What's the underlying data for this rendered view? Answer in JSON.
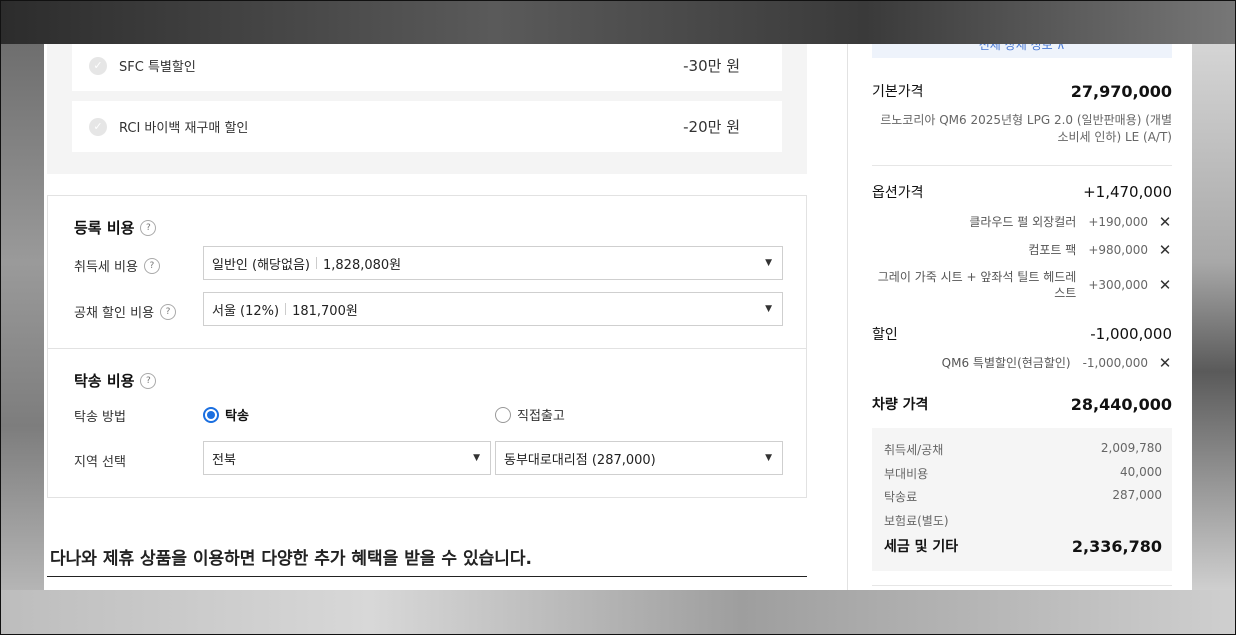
{
  "promotions": [
    {
      "label": "SFC 특별할인",
      "amount": "-30만 원"
    },
    {
      "label": "RCI 바이백 재구매 할인",
      "amount": "-20만 원"
    }
  ],
  "registration": {
    "title": "등록 비용",
    "help": "?",
    "acq_tax": {
      "label": "취득세 비용",
      "value": "일반인 (해당없음)",
      "amount": "1,828,080원"
    },
    "bond": {
      "label": "공채 할인 비용",
      "value": "서울 (12%)",
      "amount": "181,700원"
    }
  },
  "delivery": {
    "title": "탁송 비용",
    "method_label": "탁송 방법",
    "options": [
      "탁송",
      "직접출고"
    ],
    "selected": "탁송",
    "region_label": "지역 선택",
    "region": "전북",
    "branch": "동부대로대리점 (287,000)"
  },
  "partner_text": "다나와 제휴 상품을 이용하면 다양한 추가 혜택을 받을 수 있습니다.",
  "summary": {
    "top_link": "전체 상세 정보 ∧",
    "base": {
      "label": "기본가격",
      "value": "27,970,000",
      "desc": "르노코리아 QM6 2025년형 LPG 2.0 (일반판매용) (개별소비세 인하) LE (A/T)"
    },
    "options": {
      "label": "옵션가격",
      "value": "+1,470,000",
      "items": [
        {
          "name": "클라우드 펄 외장컬러",
          "price": "+190,000"
        },
        {
          "name": "컴포트 팩",
          "price": "+980,000"
        },
        {
          "name": "그레이 가죽 시트 + 앞좌석 틸트 헤드레스트",
          "price": "+300,000"
        }
      ]
    },
    "discount": {
      "label": "할인",
      "value": "-1,000,000",
      "items": [
        {
          "name": "QM6 특별할인(현금할인)",
          "price": "-1,000,000"
        }
      ]
    },
    "vehicle": {
      "label": "차량 가격",
      "value": "28,440,000"
    },
    "fees": [
      {
        "label": "취득세/공채",
        "value": "2,009,780"
      },
      {
        "label": "부대비용",
        "value": "40,000"
      },
      {
        "label": "탁송료",
        "value": "287,000"
      },
      {
        "label": "보험료(별도)",
        "value": ""
      }
    ],
    "tax_total": {
      "label": "세금 및 기타",
      "value": "2,336,780"
    }
  },
  "icons": {
    "check": "check-icon",
    "remove": "close-icon",
    "dropdown": "caret-down-icon",
    "help": "help-icon"
  }
}
